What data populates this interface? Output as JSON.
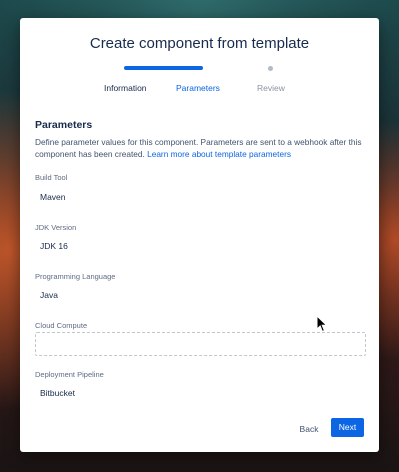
{
  "dialog": {
    "title": "Create component from template"
  },
  "steps": [
    {
      "label": "Information",
      "state": "completed"
    },
    {
      "label": "Parameters",
      "state": "current"
    },
    {
      "label": "Review",
      "state": "upcoming"
    }
  ],
  "section": {
    "heading": "Parameters",
    "description": "Define parameter values for this component. Parameters are sent to a webhook after this component has been created.",
    "link_text": "Learn more about template parameters"
  },
  "fields": [
    {
      "label": "Build Tool",
      "value": "Maven"
    },
    {
      "label": "JDK Version",
      "value": "JDK 16"
    },
    {
      "label": "Programming Language",
      "value": "Java"
    },
    {
      "label": "Cloud Compute",
      "value": ""
    },
    {
      "label": "Deployment Pipeline",
      "value": "Bitbucket"
    }
  ],
  "footer": {
    "back_label": "Back",
    "next_label": "Next"
  },
  "colors": {
    "primary": "#0c66e4",
    "text": "#172b4d",
    "muted": "#8993a4"
  }
}
